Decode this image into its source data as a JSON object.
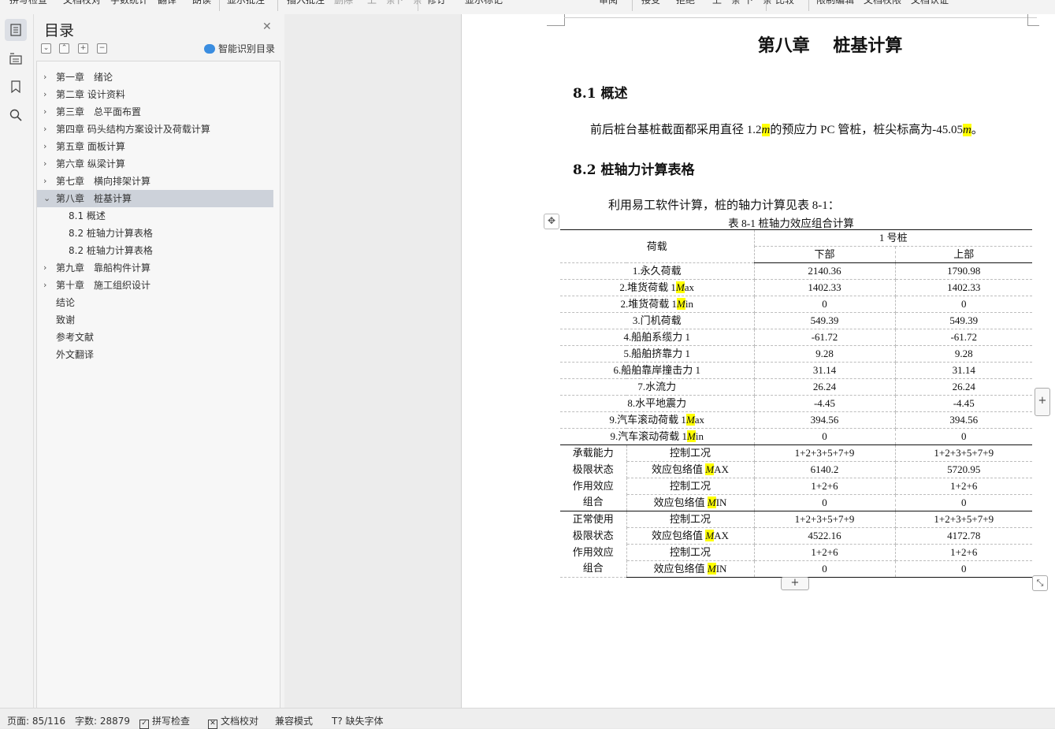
{
  "toolbar": {
    "items": [
      "拼写检查",
      "文档校对",
      "字数统计",
      "翻译",
      "朗读",
      "修订",
      "插入批注",
      "删除",
      "上一条",
      "下一条",
      "限制编辑",
      "文档权限",
      "文档认证"
    ],
    "visible": [
      "拼写检查",
      "文档校对",
      "字数统计",
      "翻译",
      "朗读",
      "显示批注",
      "插入批注",
      "删除",
      "上一条",
      "下一条",
      "修订",
      "显示标记",
      "审阅",
      "接受",
      "拒绝",
      "上一条",
      "下一条",
      "比较",
      "限制编辑",
      "文档权限",
      "文档认证"
    ]
  },
  "rail": {
    "icons": [
      "toc-icon",
      "outline-icon",
      "bookmark-icon",
      "search-icon"
    ]
  },
  "toc": {
    "title": "目录",
    "smart_label": "智能识别目录",
    "items": [
      {
        "label": "第一章　绪论",
        "level": 1,
        "expandable": true
      },
      {
        "label": "第二章  设计资料",
        "level": 1,
        "expandable": true
      },
      {
        "label": "第三章　总平面布置",
        "level": 1,
        "expandable": true
      },
      {
        "label": "第四章  码头结构方案设计及荷载计算",
        "level": 1,
        "expandable": true
      },
      {
        "label": "第五章  面板计算",
        "level": 1,
        "expandable": true
      },
      {
        "label": "第六章  纵梁计算",
        "level": 1,
        "expandable": true
      },
      {
        "label": "第七章　横向排架计算",
        "level": 1,
        "expandable": true
      },
      {
        "label": "第八章　桩基计算",
        "level": 1,
        "expanded": true,
        "selected": true
      },
      {
        "label": "8.1 概述",
        "level": 2
      },
      {
        "label": "8.2 桩轴力计算表格",
        "level": 2
      },
      {
        "label": "8.2 桩轴力计算表格",
        "level": 2
      },
      {
        "label": "第九章　靠船构件计算",
        "level": 1,
        "expandable": true
      },
      {
        "label": "第十章　施工组织设计",
        "level": 1,
        "expandable": true
      },
      {
        "label": "结论",
        "level": 1
      },
      {
        "label": "致谢",
        "level": 1
      },
      {
        "label": "参考文献",
        "level": 1
      },
      {
        "label": "外文翻译",
        "level": 1
      }
    ]
  },
  "document": {
    "chapter_title": "第八章　 桩基计算",
    "s81_title": "8.1 概述",
    "s81_text_a": "前后桩台基桩截面都采用直径 1.2",
    "s81_unit1": "m",
    "s81_text_b": "的预应力 PC 管桩，桩尖标高为-45.05",
    "s81_unit2": "m",
    "s81_text_c": "。",
    "s82_title": "8.2 桩轴力计算表格",
    "s82_text": "利用易工软件计算，桩的轴力计算见表 8-1：",
    "table_caption": "表 8-1  桩轴力效应组合计算",
    "table": {
      "header_load": "荷载",
      "header_pile": "1 号桩",
      "header_lower": "下部",
      "header_upper": "上部",
      "load_rows": [
        {
          "pre": "1.永久荷载",
          "hl": "",
          "post": "",
          "lower": "2140.36",
          "upper": "1790.98"
        },
        {
          "pre": "2.堆货荷载 1",
          "hl": "M",
          "post": "ax",
          "lower": "1402.33",
          "upper": "1402.33"
        },
        {
          "pre": "2.堆货荷载 1",
          "hl": "M",
          "post": "in",
          "lower": "0",
          "upper": "0"
        },
        {
          "pre": "3.门机荷载",
          "hl": "",
          "post": "",
          "lower": "549.39",
          "upper": "549.39"
        },
        {
          "pre": "4.船舶系缆力 1",
          "hl": "",
          "post": "",
          "lower": "-61.72",
          "upper": "-61.72"
        },
        {
          "pre": "5.船舶挤靠力 1",
          "hl": "",
          "post": "",
          "lower": "9.28",
          "upper": "9.28"
        },
        {
          "pre": "6.船舶靠岸撞击力 1",
          "hl": "",
          "post": "",
          "lower": "31.14",
          "upper": "31.14"
        },
        {
          "pre": "7.水流力",
          "hl": "",
          "post": "",
          "lower": "26.24",
          "upper": "26.24"
        },
        {
          "pre": "8.水平地震力",
          "hl": "",
          "post": "",
          "lower": "-4.45",
          "upper": "-4.45"
        },
        {
          "pre": "9.汽车滚动荷载 1",
          "hl": "M",
          "post": "ax",
          "lower": "394.56",
          "upper": "394.56"
        },
        {
          "pre": "9.汽车滚动荷载 1",
          "hl": "M",
          "post": "in",
          "lower": "0",
          "upper": "0"
        }
      ],
      "groups": [
        {
          "side": [
            "承载能力",
            "极限状态",
            "作用效应",
            "组合"
          ],
          "rows": [
            {
              "pre": "控制工况",
              "hl": "",
              "post": "",
              "lower": "1+2+3+5+7+9",
              "upper": "1+2+3+5+7+9"
            },
            {
              "pre": "效应包络值 ",
              "hl": "M",
              "post": "AX",
              "lower": "6140.2",
              "upper": "5720.95"
            },
            {
              "pre": "控制工况",
              "hl": "",
              "post": "",
              "lower": "1+2+6",
              "upper": "1+2+6"
            },
            {
              "pre": "效应包络值 ",
              "hl": "M",
              "post": "IN",
              "lower": "0",
              "upper": "0"
            }
          ]
        },
        {
          "side": [
            "正常使用",
            "极限状态",
            "作用效应",
            "组合"
          ],
          "rows": [
            {
              "pre": "控制工况",
              "hl": "",
              "post": "",
              "lower": "1+2+3+5+7+9",
              "upper": "1+2+3+5+7+9"
            },
            {
              "pre": "效应包络值 ",
              "hl": "M",
              "post": "AX",
              "lower": "4522.16",
              "upper": "4172.78"
            },
            {
              "pre": "控制工况",
              "hl": "",
              "post": "",
              "lower": "1+2+6",
              "upper": "1+2+6"
            },
            {
              "pre": "效应包络值 ",
              "hl": "M",
              "post": "IN",
              "lower": "0",
              "upper": "0"
            }
          ]
        }
      ]
    }
  },
  "status": {
    "page": "页面: 85/116",
    "words": "字数: 28879",
    "spell": "拼写检查",
    "proof": "文档校对",
    "compat": "兼容模式",
    "missing_font": "缺失字体"
  },
  "colors": {
    "highlight": "#ffff00",
    "toc_selected": "#cdd2da",
    "smart_icon": "#3a8de0"
  }
}
